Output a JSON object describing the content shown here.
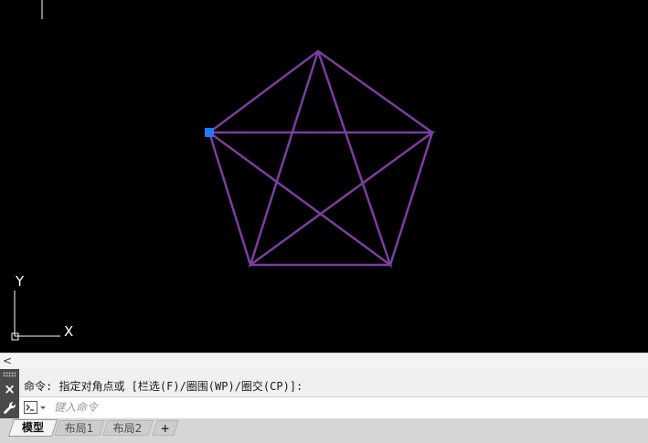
{
  "canvas": {
    "background": "#000000",
    "pentagon_color": "#7a3f9e",
    "grip_color": "#1e7bff",
    "ucs": {
      "y_label": "Y",
      "x_label": "X"
    }
  },
  "scrollbar": {
    "left_arrow": "<"
  },
  "command": {
    "close_icon": "×",
    "history_line": "命令: 指定对角点或 [栏选(F)/圈围(WP)/圈交(CP)]:",
    "input_placeholder": "键入命令",
    "input_value": ""
  },
  "tabs": [
    {
      "label": "模型",
      "active": true
    },
    {
      "label": "布局1",
      "active": false
    },
    {
      "label": "布局2",
      "active": false
    }
  ],
  "add_tab_label": "+"
}
